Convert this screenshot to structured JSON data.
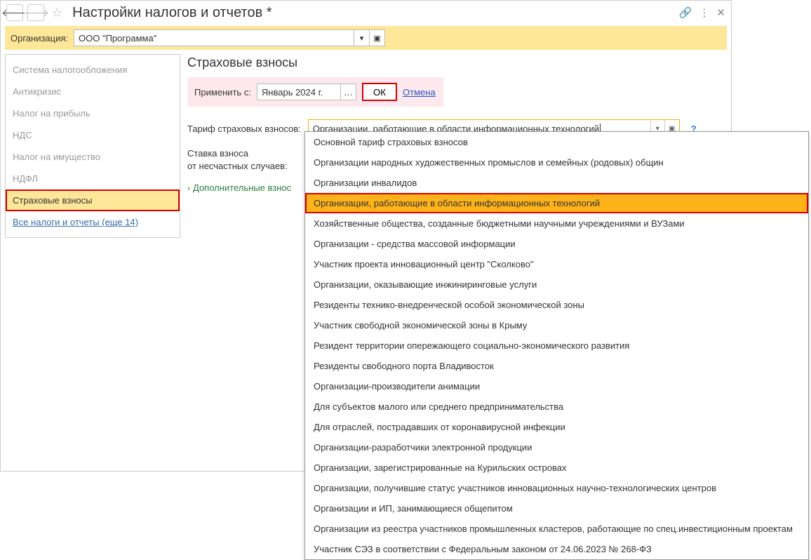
{
  "titlebar": {
    "title": "Настройки налогов и отчетов *"
  },
  "org": {
    "label": "Организация:",
    "value": "ООО \"Программа\""
  },
  "sidebar": {
    "items": [
      "Система налогообложения",
      "Антикризис",
      "Налог на прибыль",
      "НДС",
      "Налог на имущество",
      "НДФЛ",
      "Страховые взносы",
      "Все налоги и отчеты (еще 14)"
    ]
  },
  "main": {
    "title": "Страховые взносы",
    "apply_label": "Применить с:",
    "apply_value": "Январь 2024 г.",
    "ok_label": "ОК",
    "cancel_label": "Отмена",
    "tariff_label": "Тариф страховых взносов:",
    "tariff_value": "Организации, работающие в области информационных технологий",
    "rate_label_line1": "Ставка взноса",
    "rate_label_line2": "от несчастных случаев:",
    "extra_label": "Дополнительные взнос"
  },
  "dropdown": {
    "items": [
      "Основной тариф страховых взносов",
      "Организации народных художественных промыслов и семейных (родовых) общин",
      "Организации инвалидов",
      "Организации, работающие в области информационных технологий",
      "Хозяйственные общества, созданные бюджетными научными учреждениями и ВУЗами",
      "Организации - средства массовой информации",
      "Участник проекта инновационный центр \"Сколково\"",
      "Организации, оказывающие инжиниринговые услуги",
      "Резиденты технико-внедренческой особой экономической зоны",
      "Участник свободной экономической зоны в Крыму",
      "Резидент территории опережающего социально-экономического развития",
      "Резиденты свободного порта Владивосток",
      "Организации-производители анимации",
      "Для субъектов малого или среднего предпринимательства",
      "Для отраслей, пострадавших от коронавирусной инфекции",
      "Организации-разработчики электронной продукции",
      "Организации, зарегистрированные на Курильских островах",
      "Организации, получившие статус участников инновационных научно-технологических центров",
      "Организации и ИП, занимающиеся общепитом",
      "Организации из реестра участников промышленных кластеров, работающие по спец.инвестиционным проектам",
      "Участник СЭЗ в соответствии с Федеральным законом от 24.06.2023 № 268-ФЗ"
    ],
    "selected_index": 3
  }
}
